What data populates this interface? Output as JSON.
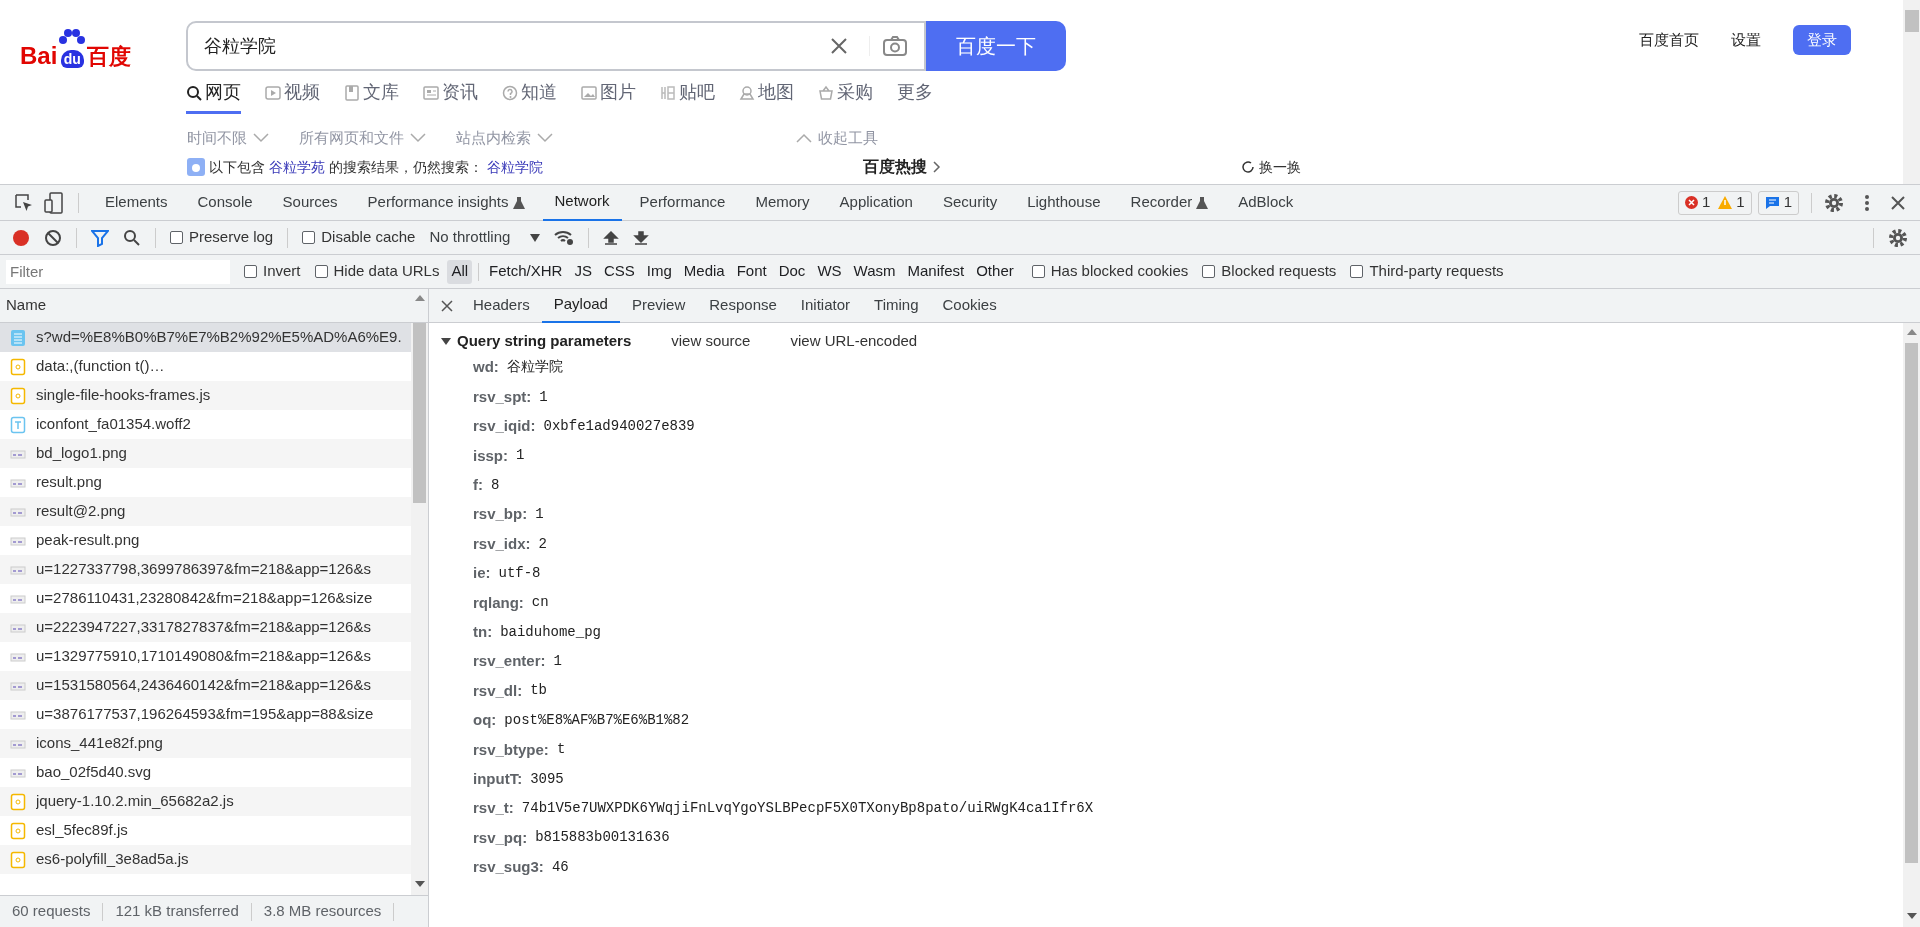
{
  "page": {
    "logo": {
      "left": "Bai",
      "paw": "du",
      "right": "百度"
    },
    "search": {
      "value": "谷粒学院",
      "button": "百度一下"
    },
    "top_links": [
      "百度首页",
      "设置"
    ],
    "login": "登录",
    "nav": [
      {
        "label": "网页",
        "kind": "search",
        "selected": true
      },
      {
        "label": "视频",
        "kind": "video",
        "selected": false
      },
      {
        "label": "文库",
        "kind": "doc",
        "selected": false
      },
      {
        "label": "资讯",
        "kind": "news",
        "selected": false
      },
      {
        "label": "知道",
        "kind": "question",
        "selected": false
      },
      {
        "label": "图片",
        "kind": "image",
        "selected": false
      },
      {
        "label": "贴吧",
        "kind": "tieba",
        "selected": false
      },
      {
        "label": "地图",
        "kind": "map",
        "selected": false
      },
      {
        "label": "采购",
        "kind": "basket",
        "selected": false
      },
      {
        "label": "更多",
        "kind": "plain",
        "selected": false
      }
    ],
    "filters": [
      "时间不限",
      "所有网页和文件",
      "站点内检索"
    ],
    "collapse": "收起工具",
    "notice": {
      "before": "以下包含",
      "link1": "谷粒学苑",
      "middle": "的搜索结果，仍然搜索：",
      "link2": "谷粒学院"
    },
    "hot": "百度热搜",
    "refresh": "换一换"
  },
  "devtools": {
    "tabs": [
      {
        "label": "Elements",
        "selected": false,
        "flask": false
      },
      {
        "label": "Console",
        "selected": false,
        "flask": false
      },
      {
        "label": "Sources",
        "selected": false,
        "flask": false
      },
      {
        "label": "Performance insights",
        "selected": false,
        "flask": true
      },
      {
        "label": "Network",
        "selected": true,
        "flask": false
      },
      {
        "label": "Performance",
        "selected": false,
        "flask": false
      },
      {
        "label": "Memory",
        "selected": false,
        "flask": false
      },
      {
        "label": "Application",
        "selected": false,
        "flask": false
      },
      {
        "label": "Security",
        "selected": false,
        "flask": false
      },
      {
        "label": "Lighthouse",
        "selected": false,
        "flask": false
      },
      {
        "label": "Recorder",
        "selected": false,
        "flask": true
      },
      {
        "label": "AdBlock",
        "selected": false,
        "flask": false
      }
    ],
    "errors": "1",
    "warnings": "1",
    "messages": "1",
    "toolbar": {
      "recording": true,
      "filter_active": true,
      "preserve_log": {
        "label": "Preserve log",
        "checked": false
      },
      "disable_cache": {
        "label": "Disable cache",
        "checked": false
      },
      "throttling": "No throttling"
    },
    "filter_bar": {
      "placeholder": "Filter",
      "invert": {
        "label": "Invert",
        "checked": false
      },
      "hide_data": {
        "label": "Hide data URLs",
        "checked": false
      },
      "types": [
        {
          "label": "All",
          "selected": true
        },
        {
          "label": "Fetch/XHR",
          "selected": false
        },
        {
          "label": "JS",
          "selected": false
        },
        {
          "label": "CSS",
          "selected": false
        },
        {
          "label": "Img",
          "selected": false
        },
        {
          "label": "Media",
          "selected": false
        },
        {
          "label": "Font",
          "selected": false
        },
        {
          "label": "Doc",
          "selected": false
        },
        {
          "label": "WS",
          "selected": false
        },
        {
          "label": "Wasm",
          "selected": false
        },
        {
          "label": "Manifest",
          "selected": false
        },
        {
          "label": "Other",
          "selected": false
        }
      ],
      "options": [
        {
          "label": "Has blocked cookies",
          "checked": false
        },
        {
          "label": "Blocked requests",
          "checked": false
        },
        {
          "label": "Third-party requests",
          "checked": false
        }
      ]
    },
    "requests_header": "Name",
    "requests": [
      {
        "name": "s?wd=%E8%B0%B7%E7%B2%92%E5%AD%A6%E9.",
        "kind": "doc",
        "selected": true
      },
      {
        "name": "data:,(function t()…",
        "kind": "script",
        "selected": false
      },
      {
        "name": "single-file-hooks-frames.js",
        "kind": "script",
        "selected": false
      },
      {
        "name": "iconfont_fa01354.woff2",
        "kind": "font",
        "selected": false
      },
      {
        "name": "bd_logo1.png",
        "kind": "image",
        "selected": false
      },
      {
        "name": "result.png",
        "kind": "image",
        "selected": false
      },
      {
        "name": "result@2.png",
        "kind": "image",
        "selected": false
      },
      {
        "name": "peak-result.png",
        "kind": "image",
        "selected": false
      },
      {
        "name": "u=1227337798,3699786397&fm=218&app=126&s",
        "kind": "image",
        "selected": false
      },
      {
        "name": "u=2786110431,23280842&fm=218&app=126&size",
        "kind": "image",
        "selected": false
      },
      {
        "name": "u=2223947227,3317827837&fm=218&app=126&s",
        "kind": "image",
        "selected": false
      },
      {
        "name": "u=1329775910,1710149080&fm=218&app=126&s",
        "kind": "image",
        "selected": false
      },
      {
        "name": "u=1531580564,2436460142&fm=218&app=126&s",
        "kind": "image",
        "selected": false
      },
      {
        "name": "u=3876177537,196264593&fm=195&app=88&size",
        "kind": "image",
        "selected": false
      },
      {
        "name": "icons_441e82f.png",
        "kind": "image",
        "selected": false
      },
      {
        "name": "bao_02f5d40.svg",
        "kind": "image",
        "selected": false
      },
      {
        "name": "jquery-1.10.2.min_65682a2.js",
        "kind": "script",
        "selected": false
      },
      {
        "name": "esl_5fec89f.js",
        "kind": "script",
        "selected": false
      },
      {
        "name": "es6-polyfill_3e8ad5a.js",
        "kind": "script",
        "selected": false
      }
    ],
    "summary": [
      "60 requests",
      "121 kB transferred",
      "3.8 MB resources"
    ],
    "detail_tabs": [
      {
        "label": "Headers",
        "selected": false
      },
      {
        "label": "Payload",
        "selected": true
      },
      {
        "label": "Preview",
        "selected": false
      },
      {
        "label": "Response",
        "selected": false
      },
      {
        "label": "Initiator",
        "selected": false
      },
      {
        "label": "Timing",
        "selected": false
      },
      {
        "label": "Cookies",
        "selected": false
      }
    ],
    "payload": {
      "title": "Query string parameters",
      "expanded": true,
      "links": [
        "view source",
        "view URL-encoded"
      ],
      "params": [
        {
          "key": "wd:",
          "value": "谷粒学院"
        },
        {
          "key": "rsv_spt:",
          "value": "1"
        },
        {
          "key": "rsv_iqid:",
          "value": "0xbfe1ad940027e839"
        },
        {
          "key": "issp:",
          "value": "1"
        },
        {
          "key": "f:",
          "value": "8"
        },
        {
          "key": "rsv_bp:",
          "value": "1"
        },
        {
          "key": "rsv_idx:",
          "value": "2"
        },
        {
          "key": "ie:",
          "value": "utf-8"
        },
        {
          "key": "rqlang:",
          "value": "cn"
        },
        {
          "key": "tn:",
          "value": "baiduhome_pg"
        },
        {
          "key": "rsv_enter:",
          "value": "1"
        },
        {
          "key": "rsv_dl:",
          "value": "tb"
        },
        {
          "key": "oq:",
          "value": "post%E8%AF%B7%E6%B1%82"
        },
        {
          "key": "rsv_btype:",
          "value": "t"
        },
        {
          "key": "inputT:",
          "value": "3095"
        },
        {
          "key": "rsv_t:",
          "value": "74b1V5e7UWXPDK6YWqjiFnLvqYgoYSLBPecpF5X0TXonyBp8pato/uiRWgK4ca1Ifr6X"
        },
        {
          "key": "rsv_pq:",
          "value": "b815883b00131636"
        },
        {
          "key": "rsv_sug3:",
          "value": "46"
        }
      ]
    }
  }
}
